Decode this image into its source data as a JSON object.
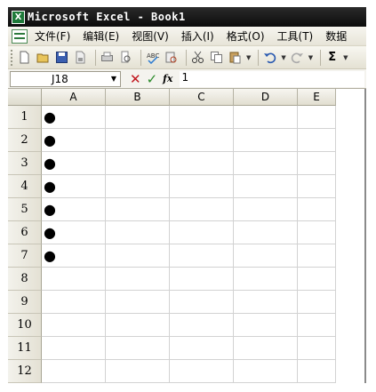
{
  "window": {
    "title": "Microsoft Excel - Book1",
    "icon_letter": "X"
  },
  "menu": {
    "items": [
      "文件(F)",
      "编辑(E)",
      "视图(V)",
      "插入(I)",
      "格式(O)",
      "工具(T)",
      "数据"
    ]
  },
  "toolbar": {
    "icons": [
      "new-icon",
      "open-icon",
      "save-icon",
      "permission-icon",
      "print-icon",
      "print-preview-icon",
      "spelling-icon",
      "research-icon",
      "cut-icon",
      "copy-icon",
      "paste-icon",
      "undo-icon",
      "redo-icon",
      "autosum-icon"
    ],
    "sum_symbol": "Σ"
  },
  "formula_bar": {
    "name_box": "J18",
    "cancel_symbol": "✕",
    "enter_symbol": "✓",
    "function_symbol": "fx",
    "value": "1"
  },
  "sheet": {
    "columns": [
      "A",
      "B",
      "C",
      "D",
      "E"
    ],
    "rows": [
      {
        "label": "1",
        "a": "●"
      },
      {
        "label": "2",
        "a": "●"
      },
      {
        "label": "3",
        "a": "●"
      },
      {
        "label": "4",
        "a": "●"
      },
      {
        "label": "5",
        "a": "●"
      },
      {
        "label": "6",
        "a": "●"
      },
      {
        "label": "7",
        "a": "●"
      },
      {
        "label": "8",
        "a": ""
      },
      {
        "label": "9",
        "a": ""
      },
      {
        "label": "10",
        "a": ""
      },
      {
        "label": "11",
        "a": ""
      },
      {
        "label": "12",
        "a": ""
      }
    ]
  },
  "colors": {
    "titlebar": "#111111",
    "cancel_red": "#c0141c",
    "enter_green": "#2a8a2a",
    "excel_green": "#1e7a3a"
  }
}
